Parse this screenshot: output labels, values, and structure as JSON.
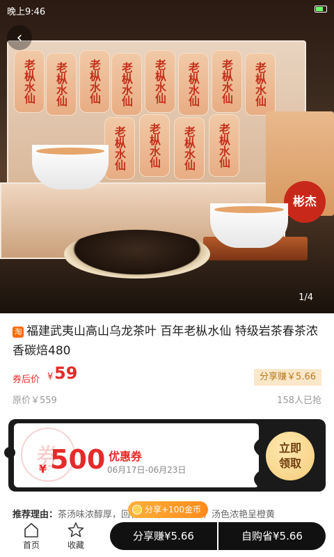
{
  "status_bar": {
    "left_text": "晚上9:46"
  },
  "hero": {
    "packet_text": "老枞水仙",
    "seal_text": "彬杰",
    "page_indicator": "1/4"
  },
  "product": {
    "platform_badge": "淘",
    "title": "福建武夷山高山乌龙茶叶 百年老枞水仙 特级岩茶春茶浓香碳焙480",
    "coupon_price_label": "券后价",
    "currency": "¥",
    "coupon_price": "59",
    "share_earn": "分享赚￥5.66",
    "original_price": "原价￥559",
    "sold_count": "158人已抢"
  },
  "coupon": {
    "watermark": "券",
    "currency": "¥",
    "amount": "500",
    "type": "优惠券",
    "date_range": "06月17日-06月23日",
    "claim_line1": "立即",
    "claim_line2": "领取"
  },
  "recommend": {
    "label": "推荐理由：",
    "text": "茶汤味浓醇厚，回甘持久，口感清爽，汤色浓艳呈橙黄"
  },
  "gold_tag": "分享+100金币",
  "bottom_nav": {
    "home": "首页",
    "favorite": "收藏",
    "share_button": "分享赚¥5.66",
    "buy_button": "自购省¥5.66"
  },
  "colors": {
    "accent_red": "#e62a2a",
    "share_tag_bg": "#fbe7c9",
    "button_dark": "#111111",
    "claim_gold": "#f4cc7a"
  },
  "icons": {
    "back": "chevron-left-icon",
    "home": "home-icon",
    "favorite": "star-icon",
    "coin": "coin-icon"
  }
}
